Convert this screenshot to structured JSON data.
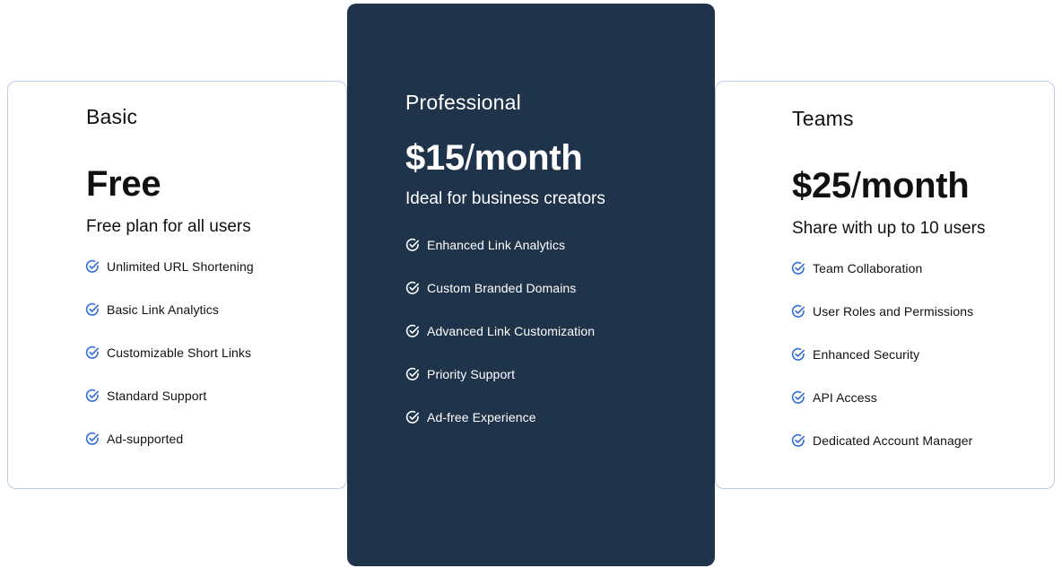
{
  "plans": [
    {
      "name": "Basic",
      "price_main": "Free",
      "price_slash": "",
      "price_period": "",
      "tagline": "Free plan for all users",
      "features": [
        "Unlimited URL Shortening",
        "Basic Link Analytics",
        "Customizable Short Links",
        "Standard Support",
        "Ad-supported"
      ]
    },
    {
      "name": "Professional",
      "price_main": "$15",
      "price_slash": "/",
      "price_period": "month",
      "tagline": "Ideal for business creators",
      "features": [
        "Enhanced Link Analytics",
        "Custom Branded Domains",
        "Advanced Link Customization",
        "Priority Support",
        "Ad-free Experience"
      ]
    },
    {
      "name": "Teams",
      "price_main": "$25",
      "price_slash": "/",
      "price_period": "month",
      "tagline": "Share with up to 10 users",
      "features": [
        "Team Collaboration",
        "User Roles and Permissions",
        "Enhanced Security",
        "API Access",
        "Dedicated Account Manager"
      ]
    }
  ],
  "colors": {
    "featured_card_bg": "#1f344b",
    "card_border": "#b9cdea",
    "check_accent": "#2f6fd8",
    "text_dark": "#111111",
    "text_light": "#ffffff"
  },
  "icons": {
    "feature_check": "check-circle-icon"
  }
}
